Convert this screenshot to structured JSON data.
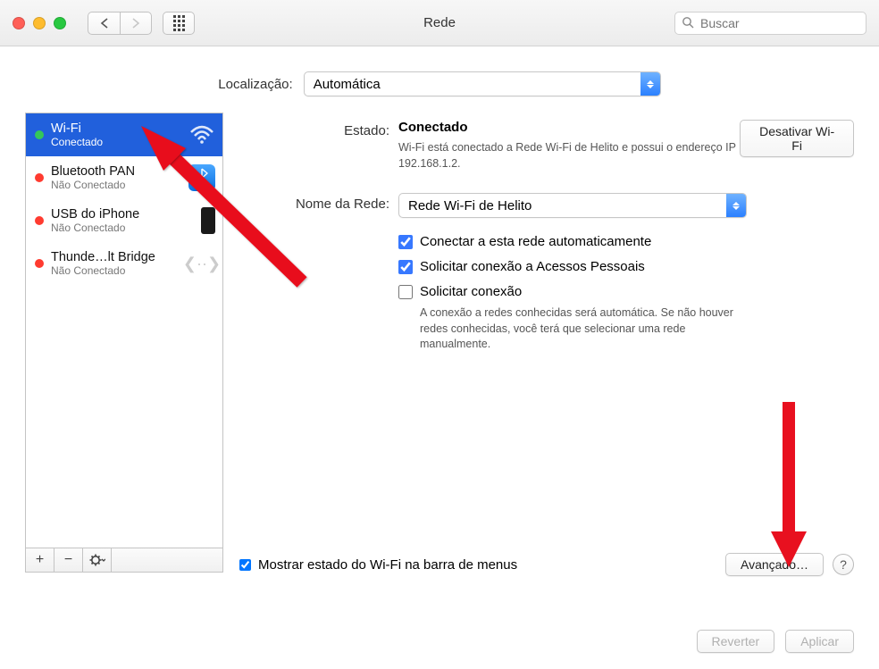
{
  "window": {
    "title": "Rede",
    "search_placeholder": "Buscar"
  },
  "location": {
    "label": "Localização:",
    "value": "Automática"
  },
  "sidebar": {
    "items": [
      {
        "name": "Wi-Fi",
        "status": "Conectado",
        "dot": "green",
        "icon": "wifi",
        "selected": true
      },
      {
        "name": "Bluetooth PAN",
        "status": "Não Conectado",
        "dot": "red",
        "icon": "bluetooth",
        "selected": false
      },
      {
        "name": "USB do iPhone",
        "status": "Não Conectado",
        "dot": "red",
        "icon": "iphone",
        "selected": false
      },
      {
        "name": "Thunde…lt Bridge",
        "status": "Não Conectado",
        "dot": "red",
        "icon": "thunderbolt",
        "selected": false
      }
    ]
  },
  "main": {
    "status_label": "Estado:",
    "status_value": "Conectado",
    "turnoff_button": "Desativar Wi-Fi",
    "status_desc": "Wi-Fi está conectado a Rede Wi-Fi de Helito e possui o endereço IP 192.168.1.2.",
    "network_name_label": "Nome da Rede:",
    "network_name_value": "Rede Wi-Fi de Helito",
    "check_auto_join": "Conectar a esta rede automaticamente",
    "check_personal_hotspot": "Solicitar conexão a Acessos Pessoais",
    "check_ask_join": "Solicitar conexão",
    "check_ask_join_desc": "A conexão a redes conhecidas será automática. Se não houver redes conhecidas, você terá que selecionar uma rede manualmente.",
    "show_menu": "Mostrar estado do Wi-Fi na barra de menus",
    "advanced_button": "Avançado…"
  },
  "footer": {
    "revert": "Reverter",
    "apply": "Aplicar"
  },
  "check_auto_join_on": true,
  "check_personal_hotspot_on": true,
  "check_ask_join_on": false,
  "show_menu_on": true
}
